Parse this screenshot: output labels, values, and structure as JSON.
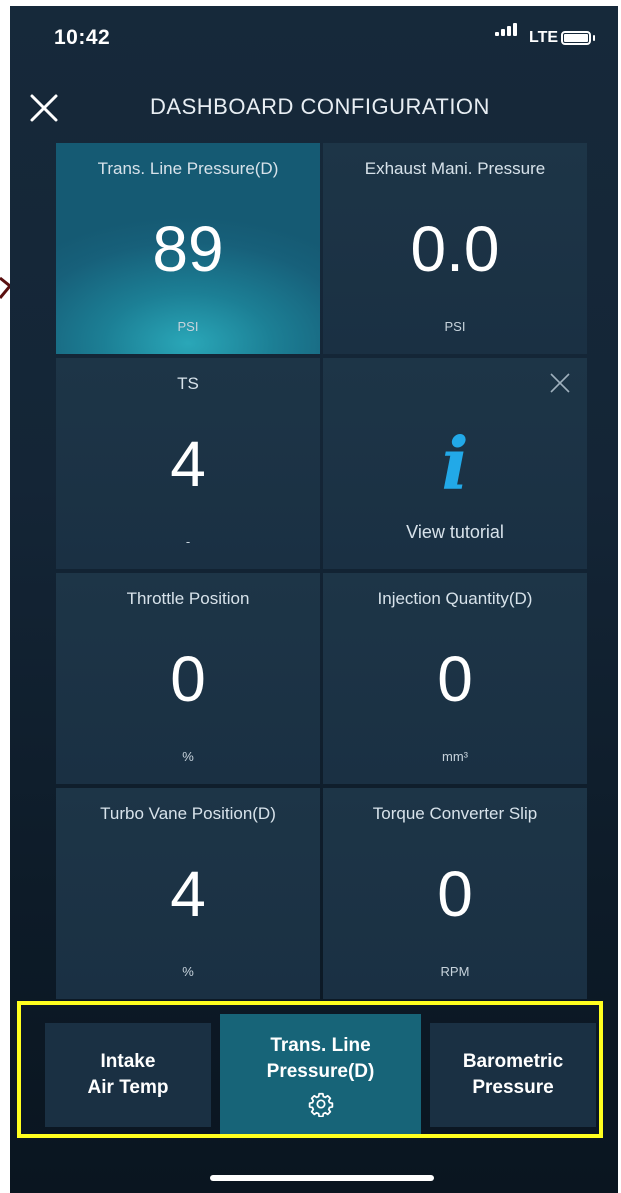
{
  "status_bar": {
    "time": "10:42",
    "network": "LTE"
  },
  "header": {
    "title": "DASHBOARD CONFIGURATION",
    "close_icon": "close-icon"
  },
  "gauges": [
    {
      "label": "Trans. Line Pressure(D)",
      "value": "89",
      "unit": "PSI",
      "selected": true
    },
    {
      "label": "Exhaust Mani. Pressure",
      "value": "0.0",
      "unit": "PSI"
    },
    {
      "label": "TS",
      "value": "4",
      "unit": "-"
    },
    {
      "label": "Throttle Position",
      "value": "0",
      "unit": "%"
    },
    {
      "label": "Injection Quantity(D)",
      "value": "0",
      "unit": "mm³"
    },
    {
      "label": "Turbo Vane Position(D)",
      "value": "4",
      "unit": "%"
    },
    {
      "label": "Torque Converter Slip",
      "value": "0",
      "unit": "RPM"
    }
  ],
  "tutorial_tile": {
    "icon": "info-icon",
    "glyph": "i",
    "text": "View tutorial"
  },
  "carousel": {
    "items": [
      {
        "line1": "Intake",
        "line2": "Air Temp"
      },
      {
        "line1": "Trans. Line",
        "line2": "Pressure(D)",
        "icon": "gear-icon"
      },
      {
        "line1": "Barometric",
        "line2": "Pressure"
      }
    ]
  },
  "colors": {
    "highlight_frame": "#ffff1f",
    "info_accent": "#22a9e8",
    "selected_tile": "#1c7f95"
  }
}
